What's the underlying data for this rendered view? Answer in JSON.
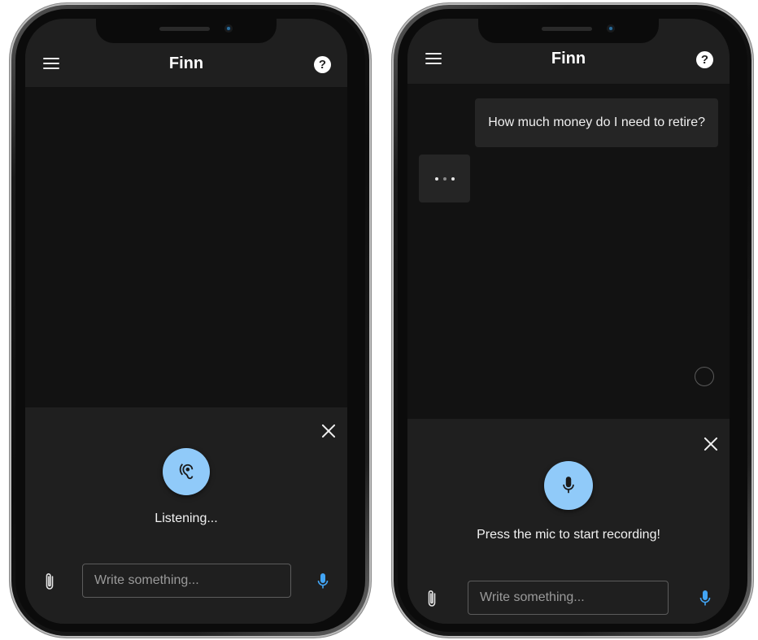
{
  "left_phone": {
    "header": {
      "title": "Finn",
      "help_symbol": "?",
      "menu_icon": "hamburger-menu-icon"
    },
    "voice_panel": {
      "status": "Listening...",
      "state_icon": "ear-icon",
      "accent_color": "#90caf9"
    },
    "composer": {
      "placeholder": "Write something...",
      "attach_icon": "paperclip-icon",
      "mic_icon": "microphone-icon"
    }
  },
  "right_phone": {
    "header": {
      "title": "Finn",
      "help_symbol": "?",
      "menu_icon": "hamburger-menu-icon"
    },
    "messages": [
      {
        "role": "user",
        "text": "How much money do I need to retire?"
      },
      {
        "role": "assistant",
        "typing": true
      }
    ],
    "voice_panel": {
      "status": "Press the mic to start recording!",
      "state_icon": "microphone-icon",
      "accent_color": "#90caf9"
    },
    "composer": {
      "placeholder": "Write something...",
      "attach_icon": "paperclip-icon",
      "mic_icon": "microphone-icon"
    }
  },
  "colors": {
    "header_bg": "#1f1f1f",
    "chat_bg": "#121212",
    "bubble_bg": "#252525",
    "mic_accent": "#90caf9",
    "mic_small": "#42a5f5"
  }
}
